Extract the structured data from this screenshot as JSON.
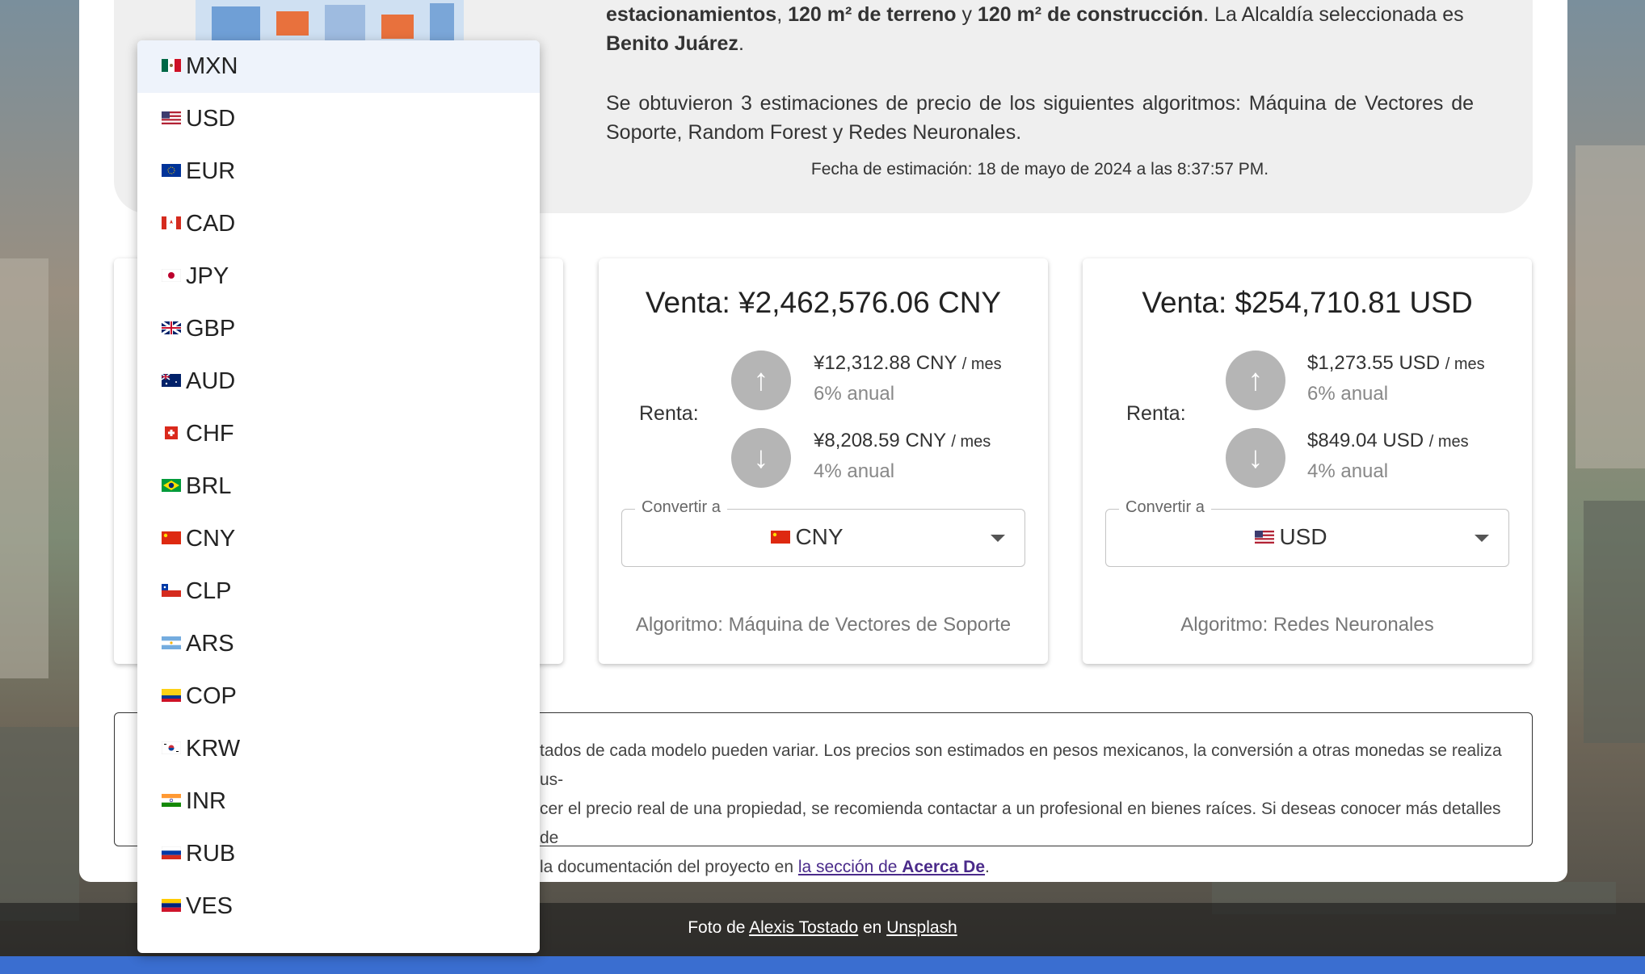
{
  "summary": {
    "line1_bold_a": "estacionamientos",
    "line1_sep_a": ", ",
    "line1_bold_b": "120 m² de terreno",
    "line1_sep_b": " y ",
    "line1_bold_c": "120 m² de construcción",
    "line1_rest": ". La Alcaldía seleccionada es",
    "alcaldia": "Benito Juárez",
    "alcaldia_end": ".",
    "paragraph2": "Se obtuvieron 3 estimaciones de precio de los siguientes algoritmos: Máquina de Vectores de Soporte, Random Forest y Redes Neuronales.",
    "date": "Fecha de estimación: 18 de mayo de 2024 a las 8:37:57 PM."
  },
  "cards": [
    {
      "venta": "Venta: ¥2,462,576.06 CNY",
      "renta_label": "Renta:",
      "rent_high": "¥12,312.88 CNY",
      "rent_high_unit": "/ mes",
      "rent_high_pct": "6% anual",
      "rent_low": "¥8,208.59 CNY",
      "rent_low_unit": "/ mes",
      "rent_low_pct": "4% anual",
      "convert_label": "Convertir a",
      "currency": "CNY",
      "currency_flag": "flag-cn",
      "algorithm": "Algoritmo: Máquina de Vectores de Soporte"
    },
    {
      "venta": "Venta: $254,710.81 USD",
      "renta_label": "Renta:",
      "rent_high": "$1,273.55 USD",
      "rent_high_unit": "/ mes",
      "rent_high_pct": "6% anual",
      "rent_low": "$849.04 USD",
      "rent_low_unit": "/ mes",
      "rent_low_pct": "4% anual",
      "convert_label": "Convertir a",
      "currency": "USD",
      "currency_flag": "flag-us",
      "algorithm": "Algoritmo: Redes Neuronales"
    }
  ],
  "disclaimer": {
    "line1": "tados de cada modelo pueden variar. Los precios son estimados en pesos mexicanos, la conversión a otras monedas se realiza us-",
    "line2": "cer el precio real de una propiedad, se recomienda contactar a un profesional en bienes raíces. Si deseas conocer más detalles de",
    "line3_pre": "la documentación del proyecto en ",
    "link_text": "la sección de ",
    "link_bold": "Acerca De",
    "line3_end": "."
  },
  "footer": {
    "pre": "Foto de ",
    "author": "Alexis Tostado",
    "mid": " en ",
    "site": "Unsplash"
  },
  "dropdown": {
    "selected": "MXN",
    "options": [
      "MXN",
      "USD",
      "EUR",
      "CAD",
      "JPY",
      "GBP",
      "AUD",
      "CHF",
      "BRL",
      "CNY",
      "CLP",
      "ARS",
      "COP",
      "KRW",
      "INR",
      "RUB",
      "VES"
    ]
  },
  "colors": {
    "accent_strip": "#3a6ed0",
    "selected_option_bg": "#eef3fb",
    "arrow_circle": "#b5b5b5"
  }
}
